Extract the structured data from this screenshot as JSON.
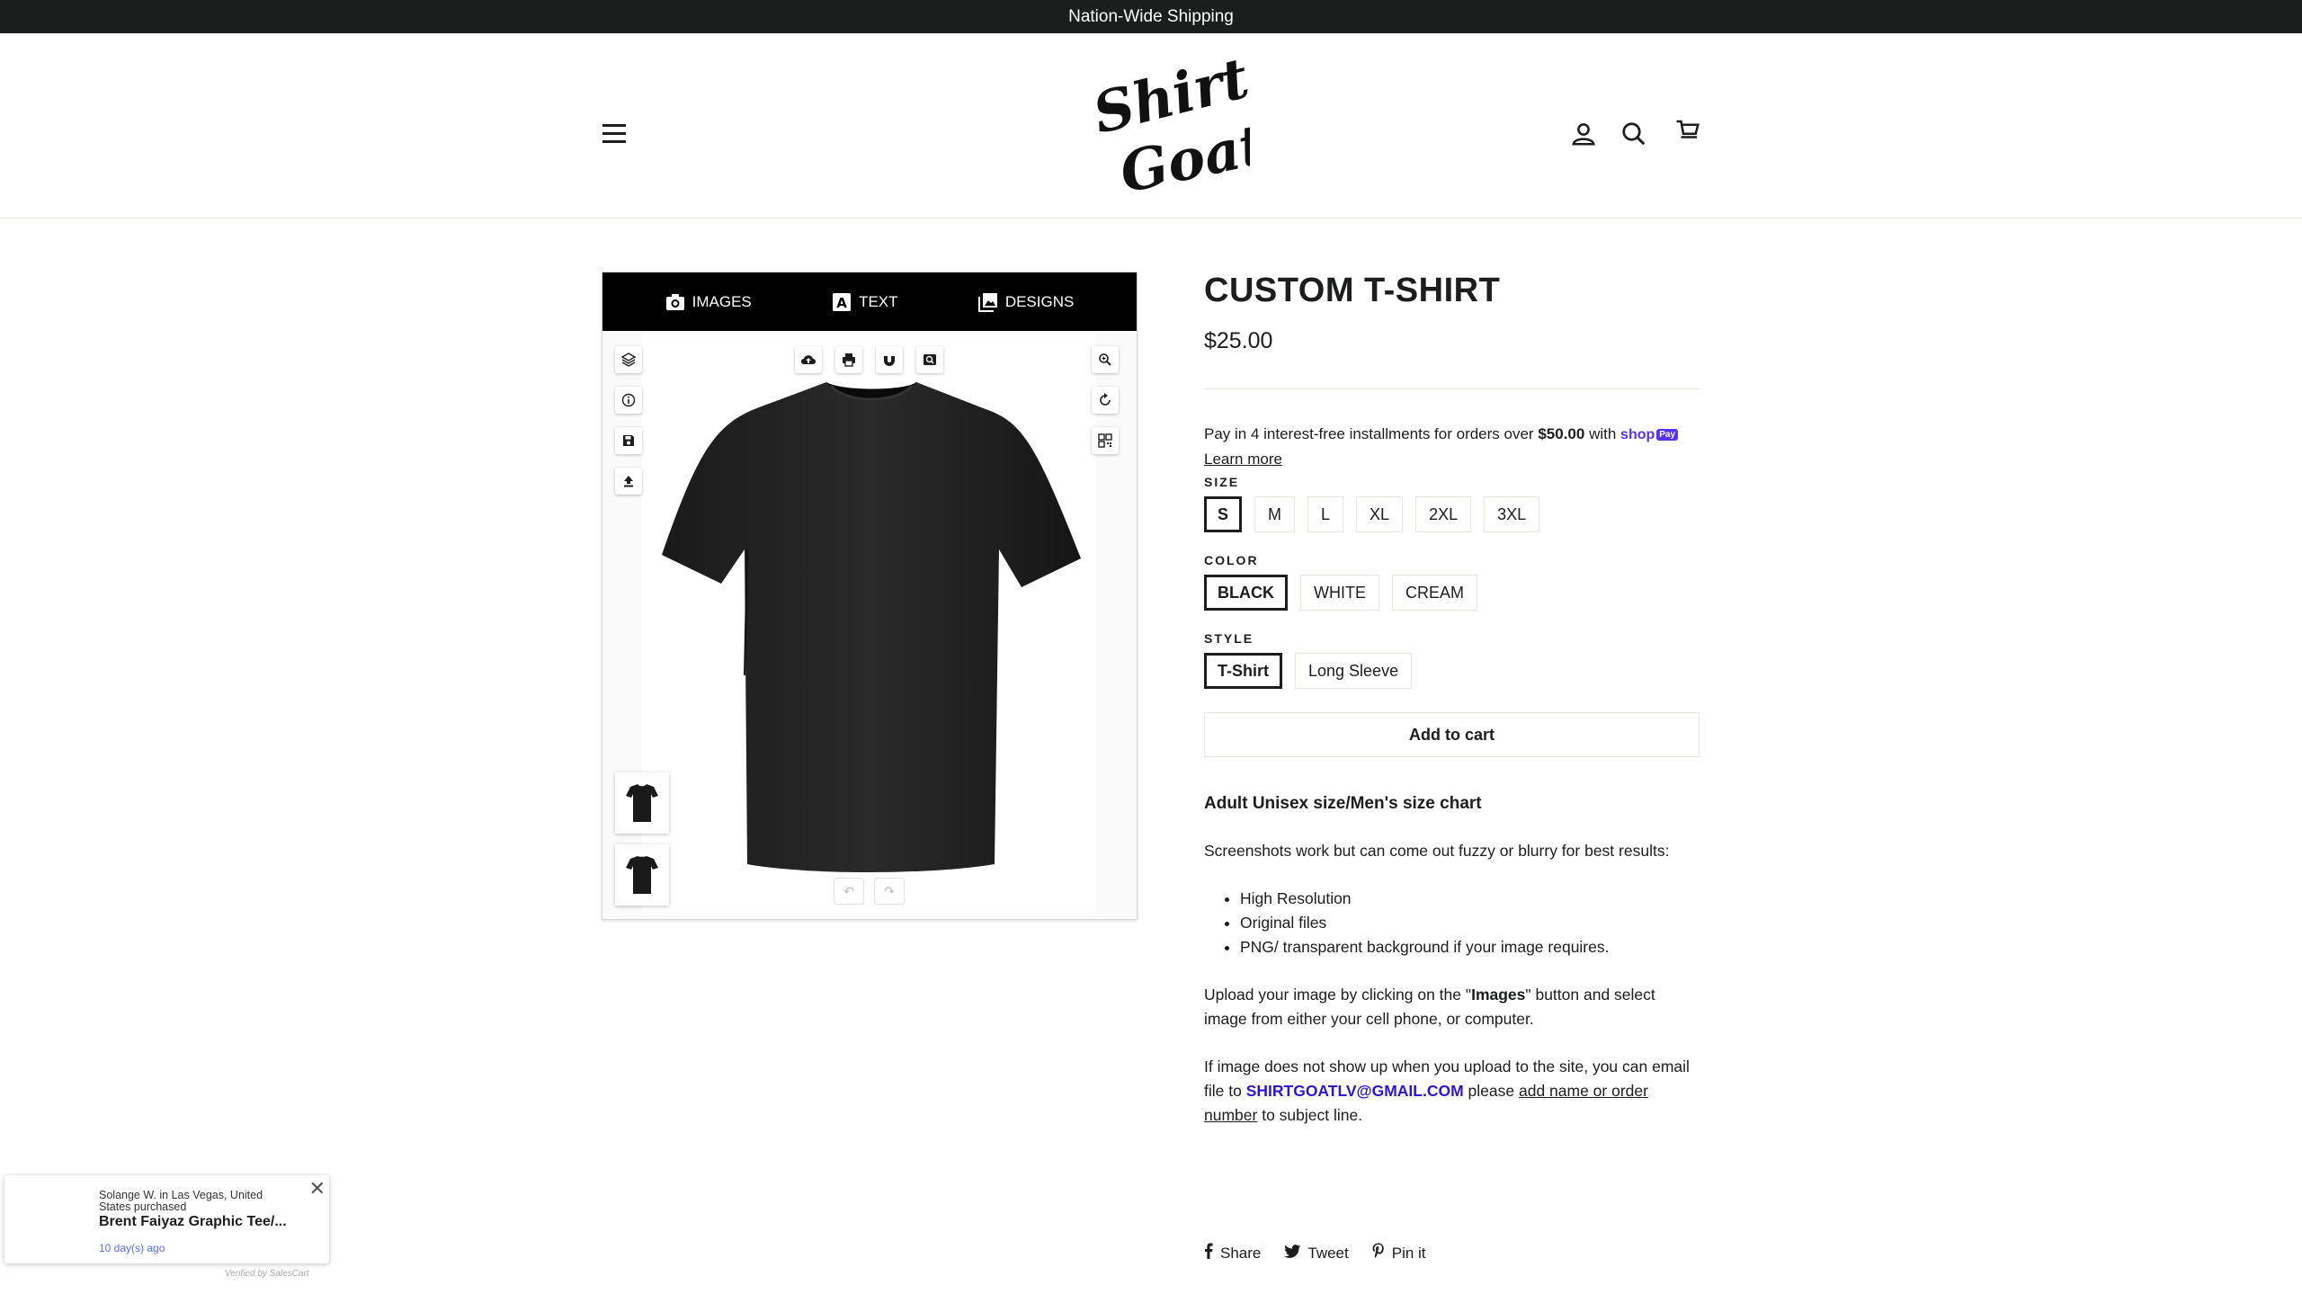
{
  "announcement": "Nation-Wide Shipping",
  "header": {
    "logo_text": "Shirt Goat",
    "menu_icon": "hamburger-icon",
    "account_icon": "user-icon",
    "search_icon": "search-icon",
    "cart_icon": "cart-icon"
  },
  "designer": {
    "tabs": [
      {
        "label": "IMAGES",
        "icon": "camera-icon"
      },
      {
        "label": "TEXT",
        "icon": "text-icon"
      },
      {
        "label": "DESIGNS",
        "icon": "designs-icon"
      }
    ],
    "left_tools": [
      "layers-icon",
      "info-icon",
      "save-icon",
      "upload-icon"
    ],
    "top_tools": [
      "cloud-icon",
      "print-icon",
      "magnet-icon",
      "preview-icon"
    ],
    "right_tools": [
      "zoom-icon",
      "reset-icon",
      "qr-icon"
    ],
    "bottom_tools": [
      "undo-icon",
      "redo-icon"
    ],
    "views": [
      "front-view",
      "back-view"
    ]
  },
  "product": {
    "title": "CUSTOM T-SHIRT",
    "price": "$25.00",
    "installments_prefix": "Pay in 4 interest-free installments for orders over",
    "installments_amount": "$50.00",
    "installments_with": "with",
    "shoppay_label": "shop",
    "shoppay_badge": "Pay",
    "learn_more": "Learn more",
    "size_label": "SIZE",
    "sizes": [
      "S",
      "M",
      "L",
      "XL",
      "2XL",
      "3XL"
    ],
    "size_selected": "S",
    "color_label": "COLOR",
    "colors": [
      "BLACK",
      "WHITE",
      "CREAM"
    ],
    "color_selected": "BLACK",
    "style_label": "STYLE",
    "styles": [
      "T-Shirt",
      "Long Sleeve"
    ],
    "style_selected": "T-Shirt",
    "add_to_cart": "Add to cart"
  },
  "description": {
    "heading": "Adult Unisex size/Men's size chart",
    "p1": "Screenshots work but can come out fuzzy or blurry for best results:",
    "bullets": [
      "High Resolution",
      "Original files",
      "PNG/ transparent background if your image requires."
    ],
    "p2_a": "Upload your image by clicking on the \"",
    "p2_b": "Images",
    "p2_c": "\" button and select image from either your cell phone, or computer.",
    "p3_a": "If image does not show up when you upload to the site, you can email file to",
    "p3_email": "SHIRTGOATLV@GMAIL.COM",
    "p3_b": "please",
    "p3_link": "add name or order number",
    "p3_c": "to subject line."
  },
  "share": [
    {
      "label": "Share",
      "icon": "facebook-icon"
    },
    {
      "label": "Tweet",
      "icon": "twitter-icon"
    },
    {
      "label": "Pin it",
      "icon": "pinterest-icon"
    }
  ],
  "popup": {
    "who": "Solange W. in Las Vegas, United States purchased",
    "item": "Brent Faiyaz Graphic Tee/...",
    "ago": "10 day(s) ago",
    "verified": "Verified by SalesCart"
  }
}
